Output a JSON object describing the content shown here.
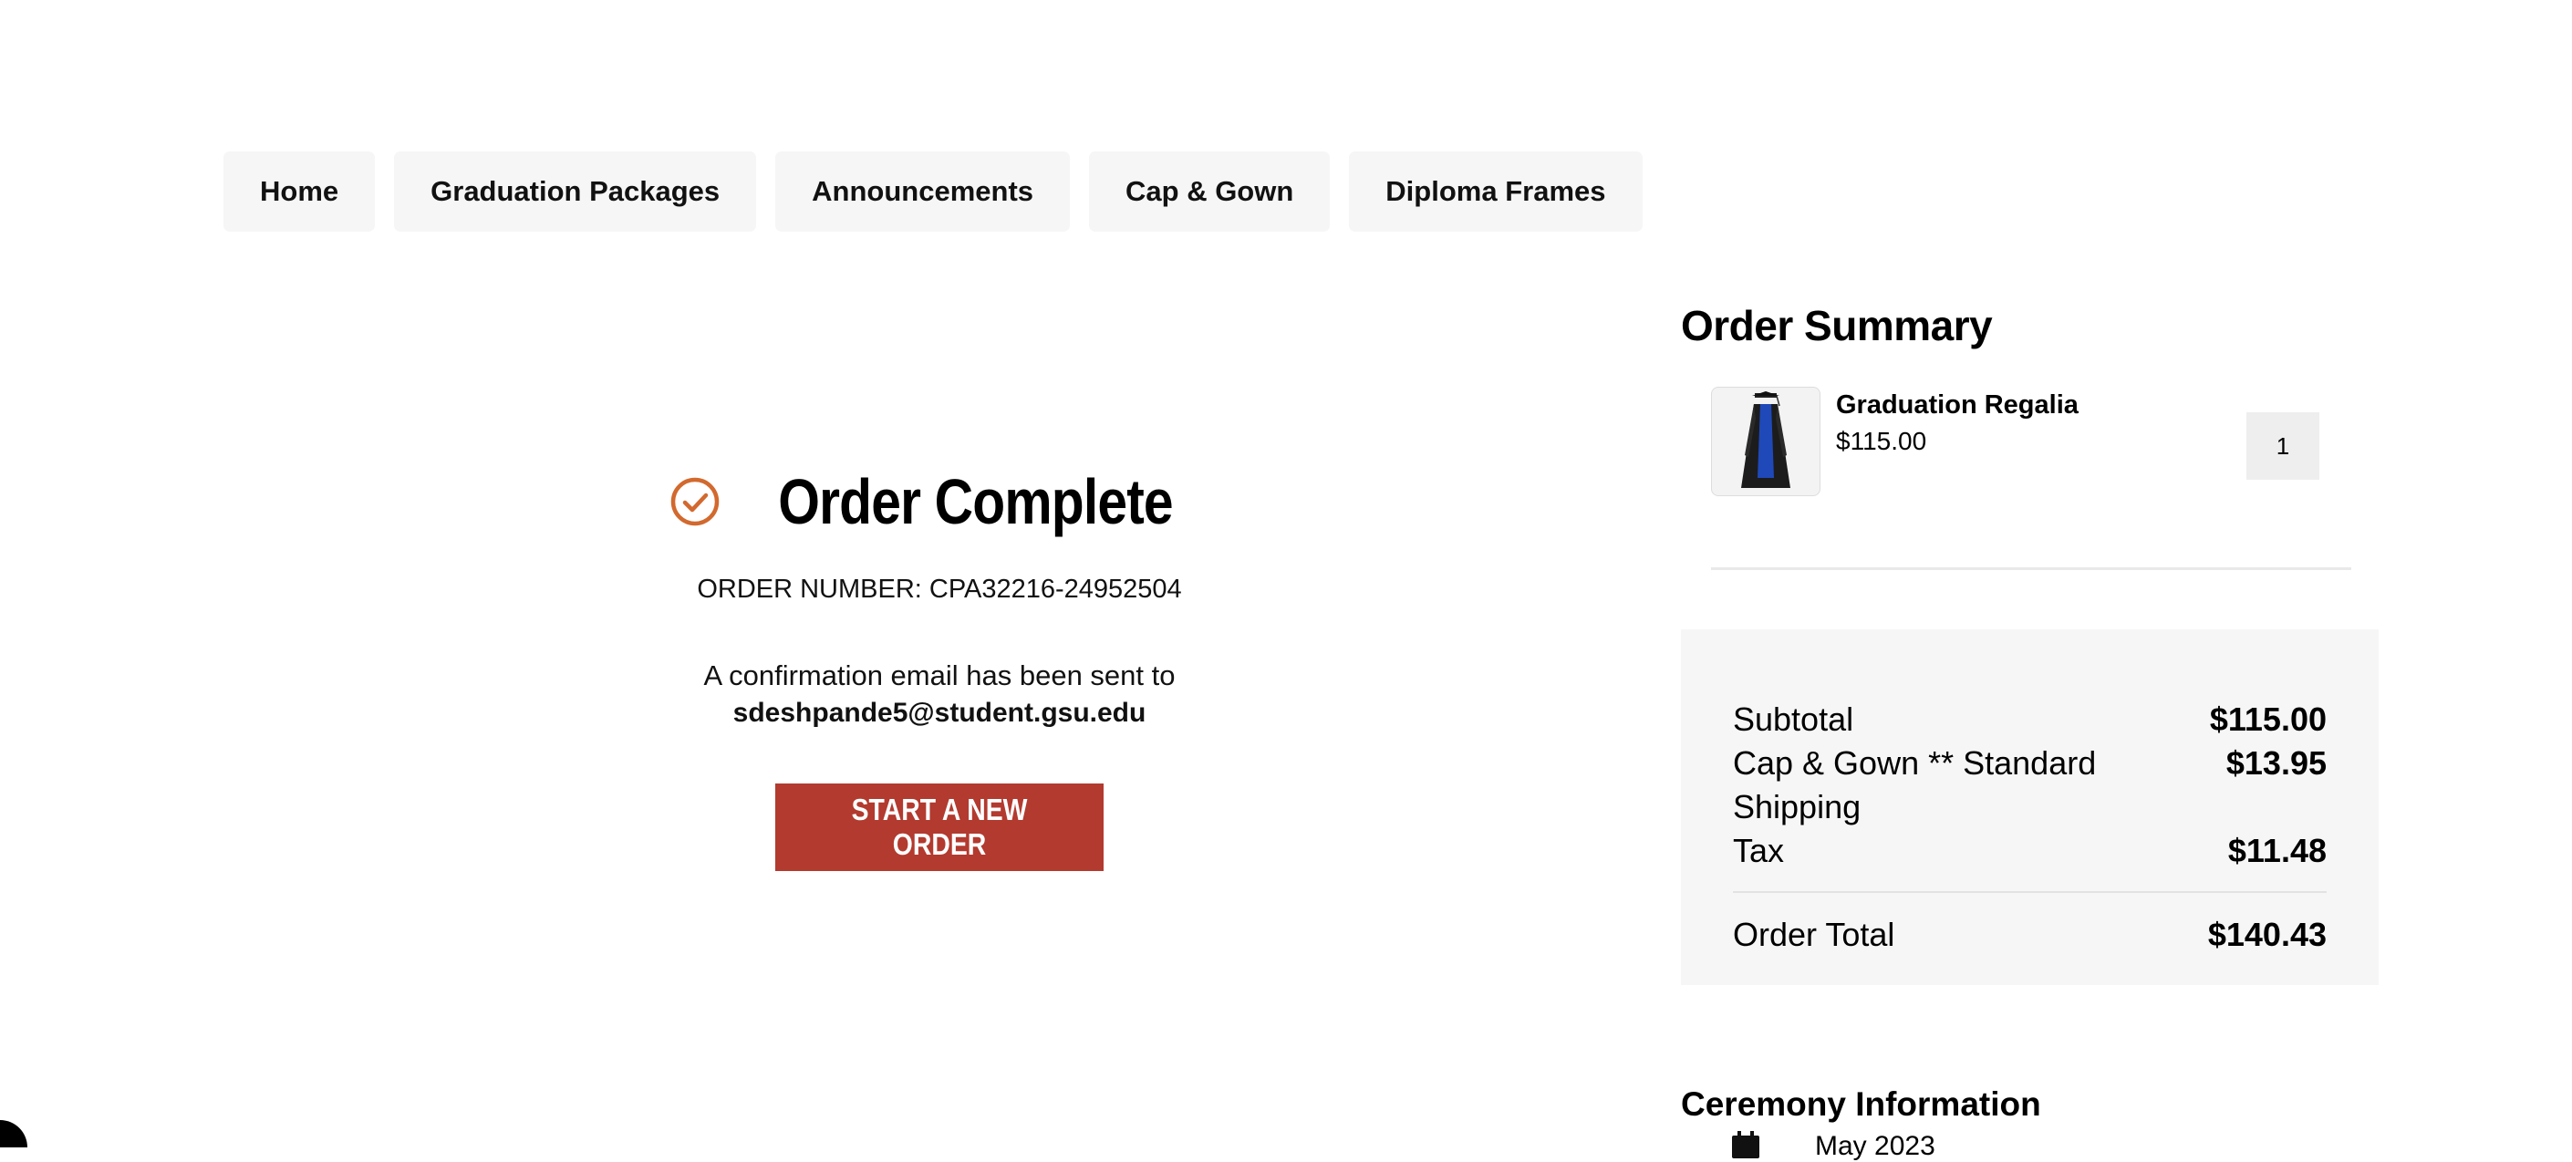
{
  "nav": {
    "items": [
      {
        "label": "Home"
      },
      {
        "label": "Graduation Packages"
      },
      {
        "label": "Announcements"
      },
      {
        "label": "Cap & Gown"
      },
      {
        "label": "Diploma Frames"
      }
    ]
  },
  "confirmation": {
    "icon": "check-circle-icon",
    "title": "Order Complete",
    "order_number_text": "ORDER NUMBER: CPA32216-24952504",
    "email_lead": "A confirmation email has been sent to",
    "email": "sdeshpande5@student.gsu.edu",
    "button_label": "START A NEW ORDER",
    "accent_color": "#d2692e",
    "button_color": "#b23a2f"
  },
  "summary": {
    "title": "Order Summary",
    "item": {
      "name": "Graduation Regalia",
      "price": "$115.00",
      "quantity": "1",
      "image_icon": "gown-image"
    },
    "rows": [
      {
        "label": "Subtotal",
        "value": "$115.00"
      },
      {
        "label": "Cap & Gown ** Standard Shipping",
        "value": "$13.95"
      },
      {
        "label": "Tax",
        "value": "$11.48"
      }
    ],
    "total": {
      "label": "Order Total",
      "value": "$140.43"
    }
  },
  "ceremony": {
    "title": "Ceremony Information",
    "icon": "calendar-icon",
    "date": "May 2023"
  }
}
